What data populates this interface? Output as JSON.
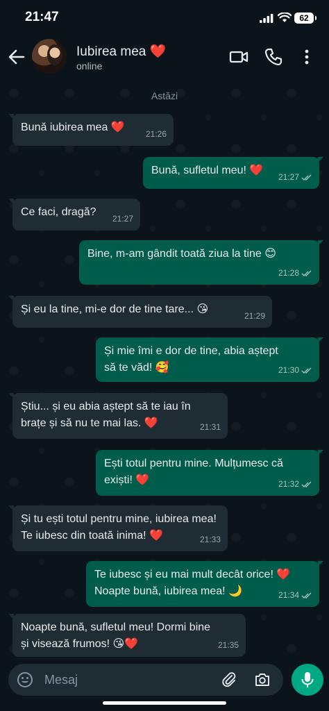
{
  "status": {
    "time": "21:47",
    "battery": "62"
  },
  "header": {
    "name": "Iubirea mea ❤️",
    "status": "online"
  },
  "chat": {
    "date_chip": "Astăzi",
    "messages": [
      {
        "dir": "in",
        "text": "Bună iubirea mea ❤️",
        "time": "21:26"
      },
      {
        "dir": "out",
        "text": "Bună, sufletul meu! ❤️",
        "time": "21:27"
      },
      {
        "dir": "in",
        "text": "Ce faci, dragă?",
        "time": "21:27"
      },
      {
        "dir": "out",
        "text": "Bine, m-am gândit toată ziua la tine 😊",
        "time": "21:28"
      },
      {
        "dir": "in",
        "text": "Și eu la tine, mi-e dor de tine tare... 😘",
        "time": "21:29"
      },
      {
        "dir": "out",
        "text": "Și mie îmi e dor de tine, abia aștept\nsă te văd! 🥰",
        "time": "21:30"
      },
      {
        "dir": "in",
        "text": "Știu... și eu abia aștept să te iau în\nbrațe și să nu te mai las. ❤️",
        "time": "21:31"
      },
      {
        "dir": "out",
        "text": "Ești totul pentru mine. Mulțumesc că\nexiști! ❤️",
        "time": "21:32"
      },
      {
        "dir": "in",
        "text": "Și tu ești totul pentru mine, iubirea mea!\nTe iubesc din toată inima! ❤️",
        "time": "21:33"
      },
      {
        "dir": "out",
        "text": "Te iubesc și eu mai mult decât orice! ❤️\nNoapte bună, iubirea mea! 🌙",
        "time": "21:34"
      },
      {
        "dir": "in",
        "text": "Noapte bună, sufletul meu! Dormi bine\nși visează frumos! 😘❤️",
        "time": "21:35"
      }
    ]
  },
  "input": {
    "placeholder": "Mesaj"
  },
  "colors": {
    "incoming": "#202c33",
    "outgoing": "#005c4b",
    "accent": "#00a884",
    "background": "#0b141a"
  }
}
